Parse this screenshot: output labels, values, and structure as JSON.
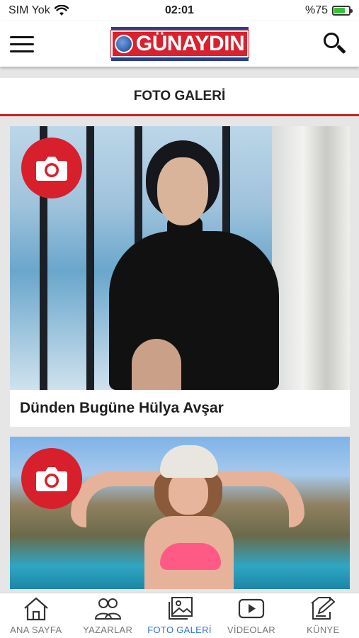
{
  "status_bar": {
    "carrier": "SIM Yok",
    "time": "02:01",
    "battery_text": "%75",
    "battery_level": 0.75
  },
  "header": {
    "logo_text": "GÜNAYDIN"
  },
  "section": {
    "title": "FOTO GALERİ"
  },
  "cards": [
    {
      "title": "Dünden Bugüne Hülya Avşar"
    },
    {
      "title": ""
    }
  ],
  "tabbar": {
    "tabs": [
      {
        "label": "ANA SAYFA",
        "icon": "home-icon",
        "active": false
      },
      {
        "label": "YAZARLAR",
        "icon": "users-icon",
        "active": false
      },
      {
        "label": "FOTO GALERİ",
        "icon": "gallery-icon",
        "active": true
      },
      {
        "label": "VİDEOLAR",
        "icon": "video-icon",
        "active": false
      },
      {
        "label": "KÜNYE",
        "icon": "edit-icon",
        "active": false
      }
    ]
  },
  "colors": {
    "brand_red": "#d7202c",
    "brand_blue": "#2a3d8f",
    "active_tab": "#2f74d0",
    "inactive_tab": "#777777"
  }
}
